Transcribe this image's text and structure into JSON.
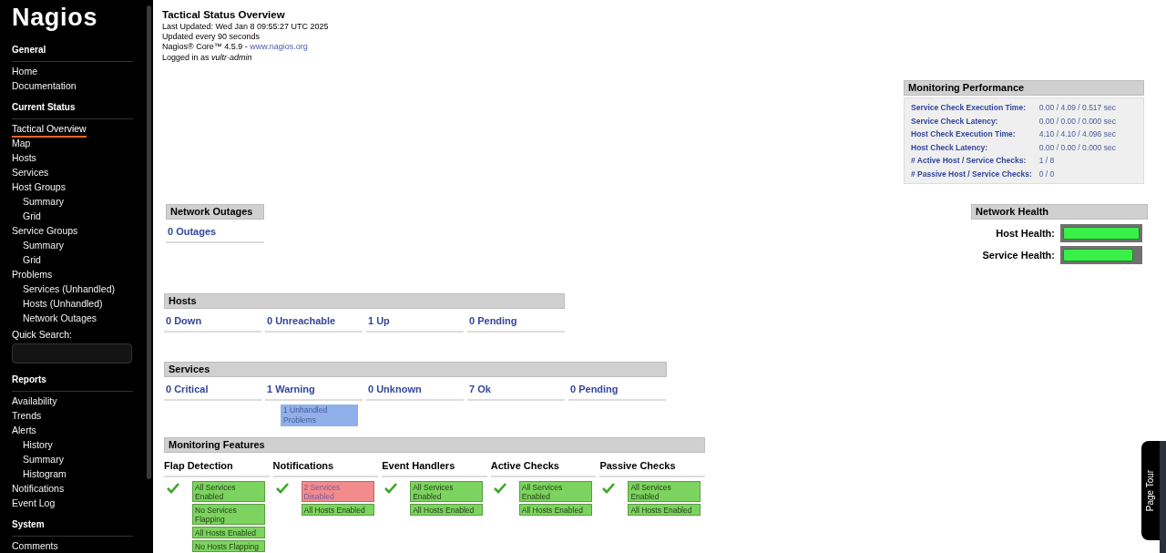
{
  "sidebar": {
    "logo": "Nagios",
    "sections": [
      {
        "title": "General",
        "items": [
          {
            "label": "Home",
            "selected": false
          },
          {
            "label": "Documentation",
            "selected": false
          }
        ]
      },
      {
        "title": "Current Status",
        "items": [
          {
            "label": "Tactical Overview",
            "selected": true
          },
          {
            "label": "Map",
            "selected": false
          },
          {
            "label": "Hosts",
            "selected": false
          },
          {
            "label": "Services",
            "selected": false
          },
          {
            "label": "Host Groups",
            "selected": false,
            "children": [
              {
                "label": "Summary",
                "selected": false
              },
              {
                "label": "Grid",
                "selected": false
              }
            ]
          },
          {
            "label": "Service Groups",
            "selected": false,
            "children": [
              {
                "label": "Summary",
                "selected": false
              },
              {
                "label": "Grid",
                "selected": false
              }
            ]
          },
          {
            "label": "Problems",
            "selected": false,
            "children": [
              {
                "label": "Services (Unhandled)",
                "selected": false
              },
              {
                "label": "Hosts (Unhandled)",
                "selected": false
              },
              {
                "label": "Network Outages",
                "selected": false
              }
            ]
          }
        ],
        "search": {
          "label": "Quick Search:"
        }
      },
      {
        "title": "Reports",
        "items": [
          {
            "label": "Availability",
            "selected": false
          },
          {
            "label": "Trends",
            "selected": false
          },
          {
            "label": "Alerts",
            "selected": false,
            "children": [
              {
                "label": "History",
                "selected": false
              },
              {
                "label": "Summary",
                "selected": false
              },
              {
                "label": "Histogram",
                "selected": false
              }
            ]
          },
          {
            "label": "Notifications",
            "selected": false
          },
          {
            "label": "Event Log",
            "selected": false
          }
        ]
      },
      {
        "title": "System",
        "items": [
          {
            "label": "Comments",
            "selected": false
          }
        ]
      }
    ]
  },
  "header": {
    "title": "Tactical Status Overview",
    "last_updated": "Last Updated: Wed Jan 8 09:55:27 UTC 2025",
    "interval": "Updated every 90 seconds",
    "version": "Nagios® Core™ 4.5.9 - ",
    "link": "www.nagios.org",
    "login_prefix": "Logged in as ",
    "user": "vultr-admin"
  },
  "monitoring_performance": {
    "title": "Monitoring Performance",
    "rows": [
      {
        "label": "Service Check Execution Time:",
        "value": "0.00 / 4.09 / 0.517 sec"
      },
      {
        "label": "Service Check Latency:",
        "value": "0.00 / 0.00 / 0.000 sec"
      },
      {
        "label": "Host Check Execution Time:",
        "value": "4.10 / 4.10 / 4.096 sec"
      },
      {
        "label": "Host Check Latency:",
        "value": "0.00 / 0.00 / 0.000 sec"
      },
      {
        "label": "# Active Host / Service Checks:",
        "value": "1 / 8"
      },
      {
        "label": "# Passive Host / Service Checks:",
        "value": "0 / 0"
      }
    ]
  },
  "network_outages": {
    "title": "Network Outages",
    "items": [
      "0 Outages"
    ]
  },
  "network_health": {
    "title": "Network Health",
    "bars": [
      {
        "label": "Host Health:",
        "level": 1
      },
      {
        "label": "Service Health:",
        "level": 0.92
      }
    ]
  },
  "hosts": {
    "title": "Hosts",
    "cells": [
      {
        "label": "0 Down"
      },
      {
        "label": "0 Unreachable"
      },
      {
        "label": "1 Up"
      },
      {
        "label": "0 Pending"
      }
    ]
  },
  "services": {
    "title": "Services",
    "cells": [
      {
        "label": "0 Critical"
      },
      {
        "label": "1 Warning",
        "badges": [
          "1 Unhandled Problems"
        ]
      },
      {
        "label": "0 Unknown"
      },
      {
        "label": "7 Ok"
      },
      {
        "label": "0 Pending"
      }
    ]
  },
  "monitoring_features": {
    "title": "Monitoring Features",
    "columns": [
      {
        "title": "Flap Detection",
        "badges": [
          {
            "label": "All Services Enabled",
            "kind": "ok"
          },
          {
            "label": "No Services Flapping",
            "kind": "ok"
          },
          {
            "label": "All Hosts Enabled",
            "kind": "ok"
          },
          {
            "label": "No Hosts Flapping",
            "kind": "ok"
          }
        ]
      },
      {
        "title": "Notifications",
        "badges": [
          {
            "label": "2 Services Disabled",
            "kind": "problem"
          },
          {
            "label": "All Hosts Enabled",
            "kind": "ok"
          }
        ]
      },
      {
        "title": "Event Handlers",
        "badges": [
          {
            "label": "All Services Enabled",
            "kind": "ok"
          },
          {
            "label": "All Hosts Enabled",
            "kind": "ok"
          }
        ]
      },
      {
        "title": "Active Checks",
        "badges": [
          {
            "label": "All Services Enabled",
            "kind": "ok"
          },
          {
            "label": "All Hosts Enabled",
            "kind": "ok"
          }
        ]
      },
      {
        "title": "Passive Checks",
        "badges": [
          {
            "label": "All Services Enabled",
            "kind": "ok"
          },
          {
            "label": "All Hosts Enabled",
            "kind": "ok"
          }
        ]
      }
    ]
  },
  "page_tour": {
    "label": "Page Tour"
  }
}
